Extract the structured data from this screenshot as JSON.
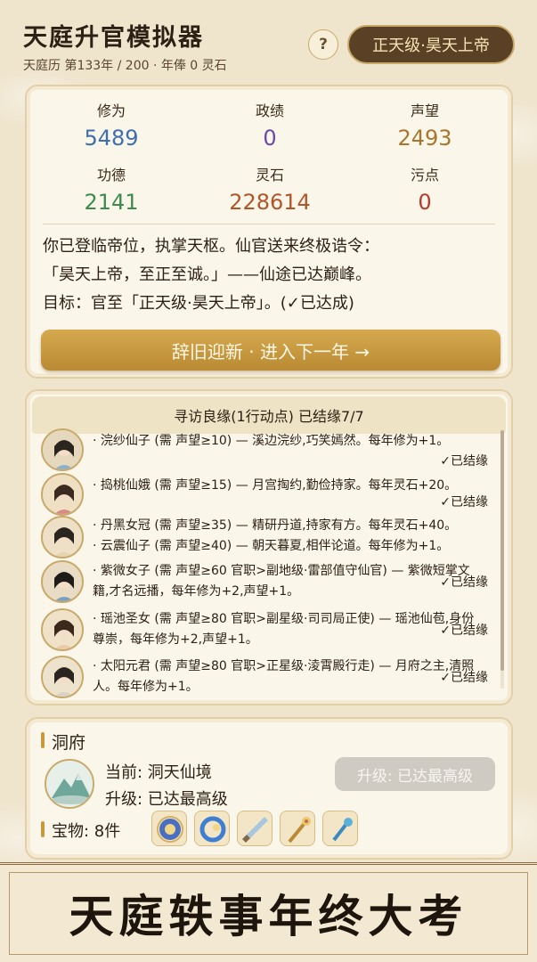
{
  "header": {
    "title": "天庭升官模拟器",
    "subtitle": "天庭历 第133年 / 200 · 年俸 0 灵石",
    "help_label": "?",
    "rank": "正天级·昊天上帝"
  },
  "stats": [
    {
      "label": "修为",
      "value": "5489",
      "color": "#3d6fb0"
    },
    {
      "label": "政绩",
      "value": "0",
      "color": "#6a4aa8"
    },
    {
      "label": "声望",
      "value": "2493",
      "color": "#a7752c"
    },
    {
      "label": "功德",
      "value": "2141",
      "color": "#3e8a4f"
    },
    {
      "label": "灵石",
      "value": "228614",
      "color": "#b0562a"
    },
    {
      "label": "污点",
      "value": "0",
      "color": "#b33a2e"
    }
  ],
  "story": {
    "line1": "你已登临帝位，执掌天枢。仙官送来终极诰令：",
    "line2": "「昊天上帝，至正至诚。」——仙途已达巅峰。",
    "line3": "目标：官至「正天级·昊天上帝」。(✓已达成)"
  },
  "next_button": "辞旧迎新 · 进入下一年 →",
  "encounters": {
    "header": "寻访良缘(1行动点) 已结缘7/7",
    "status_label": "✓已结缘",
    "items": [
      {
        "text": "· 浣纱仙子 (需 声望≥10) — 溪边浣纱,巧笑嫣然。每年修为+1。"
      },
      {
        "text": "· 捣桃仙娥 (需 声望≥15) — 月宫掏约,勤俭持家。每年灵石+20。"
      },
      {
        "text": "· 丹黑女冠 (需 声望≥35) — 精研丹道,持家有方。每年灵石+40。"
      },
      {
        "text": "· 云震仙子 (需 声望≥40) — 朝天暮夏,相伴论道。每年修为+1。"
      },
      {
        "text": "· 紫微女子 (需 声望≥60 官职>副地级·雷部值守仙官) — 紫微短掌文籍,才名远播，每年修为+2,声望+1。"
      },
      {
        "text": "· 瑶池圣女 (需 声望≥80 官职>副星级·司司局正使) — 瑶池仙苞,身份尊崇，每年修为+2,声望+1。"
      },
      {
        "text": "· 太阳元君 (需 声望≥80 官职>正星级·淩霄殿行走) — 月府之主,清照人。每年修为+1。"
      }
    ]
  },
  "dongfu": {
    "title": "洞府",
    "current": "当前: 洞天仙境",
    "upgrade": "升级: 已达最高级",
    "upgrade_button": "升级: 已达最高级",
    "treasure_label": "宝物: 8件"
  },
  "banner": "天庭轶事年终大考"
}
